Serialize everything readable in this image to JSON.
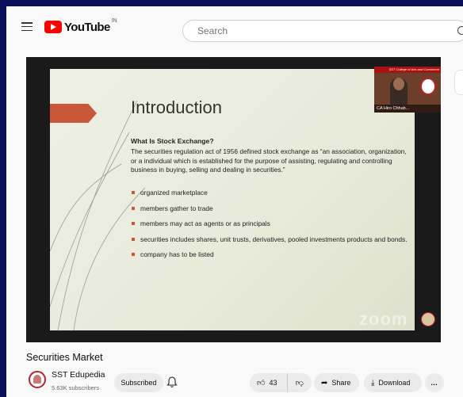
{
  "header": {
    "logo_text": "YouTube",
    "logo_region": "IN",
    "search_placeholder": "Search"
  },
  "video": {
    "slide": {
      "title": "Introduction",
      "subtitle": "What Is Stock Exchange?",
      "paragraph": "The securities regulation act of 1956 defined stock exchange as “an association, organization, or a individual which is established for the purpose of assisting, regulating and controlling business in buying, selling and dealing in securities.”",
      "bullets": [
        "organized marketplace",
        "members gather to trade",
        "members may act as agents or as principals",
        "securities includes shares, unit trusts,  derivatives, pooled  investments products and bonds.",
        "company has to be listed"
      ]
    },
    "camera": {
      "header": "SST College of Arts and Commerce",
      "name": "CA Hiro Chhab..."
    },
    "watermark": "zoom"
  },
  "title": "Securities Market",
  "channel": {
    "name": "SST Edupedia",
    "subscribers": "5.63K subscribers"
  },
  "actions": {
    "subscribed_label": "Subscribed",
    "like_count": "43",
    "share_label": "Share",
    "download_label": "Download",
    "more_label": "…"
  }
}
